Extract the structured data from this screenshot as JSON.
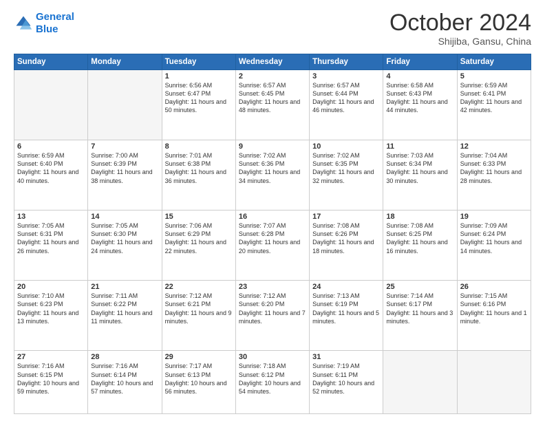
{
  "logo": {
    "line1": "General",
    "line2": "Blue"
  },
  "title": "October 2024",
  "location": "Shijiba, Gansu, China",
  "days_header": [
    "Sunday",
    "Monday",
    "Tuesday",
    "Wednesday",
    "Thursday",
    "Friday",
    "Saturday"
  ],
  "weeks": [
    [
      {
        "day": "",
        "info": ""
      },
      {
        "day": "",
        "info": ""
      },
      {
        "day": "1",
        "info": "Sunrise: 6:56 AM\nSunset: 6:47 PM\nDaylight: 11 hours and 50 minutes."
      },
      {
        "day": "2",
        "info": "Sunrise: 6:57 AM\nSunset: 6:45 PM\nDaylight: 11 hours and 48 minutes."
      },
      {
        "day": "3",
        "info": "Sunrise: 6:57 AM\nSunset: 6:44 PM\nDaylight: 11 hours and 46 minutes."
      },
      {
        "day": "4",
        "info": "Sunrise: 6:58 AM\nSunset: 6:43 PM\nDaylight: 11 hours and 44 minutes."
      },
      {
        "day": "5",
        "info": "Sunrise: 6:59 AM\nSunset: 6:41 PM\nDaylight: 11 hours and 42 minutes."
      }
    ],
    [
      {
        "day": "6",
        "info": "Sunrise: 6:59 AM\nSunset: 6:40 PM\nDaylight: 11 hours and 40 minutes."
      },
      {
        "day": "7",
        "info": "Sunrise: 7:00 AM\nSunset: 6:39 PM\nDaylight: 11 hours and 38 minutes."
      },
      {
        "day": "8",
        "info": "Sunrise: 7:01 AM\nSunset: 6:38 PM\nDaylight: 11 hours and 36 minutes."
      },
      {
        "day": "9",
        "info": "Sunrise: 7:02 AM\nSunset: 6:36 PM\nDaylight: 11 hours and 34 minutes."
      },
      {
        "day": "10",
        "info": "Sunrise: 7:02 AM\nSunset: 6:35 PM\nDaylight: 11 hours and 32 minutes."
      },
      {
        "day": "11",
        "info": "Sunrise: 7:03 AM\nSunset: 6:34 PM\nDaylight: 11 hours and 30 minutes."
      },
      {
        "day": "12",
        "info": "Sunrise: 7:04 AM\nSunset: 6:33 PM\nDaylight: 11 hours and 28 minutes."
      }
    ],
    [
      {
        "day": "13",
        "info": "Sunrise: 7:05 AM\nSunset: 6:31 PM\nDaylight: 11 hours and 26 minutes."
      },
      {
        "day": "14",
        "info": "Sunrise: 7:05 AM\nSunset: 6:30 PM\nDaylight: 11 hours and 24 minutes."
      },
      {
        "day": "15",
        "info": "Sunrise: 7:06 AM\nSunset: 6:29 PM\nDaylight: 11 hours and 22 minutes."
      },
      {
        "day": "16",
        "info": "Sunrise: 7:07 AM\nSunset: 6:28 PM\nDaylight: 11 hours and 20 minutes."
      },
      {
        "day": "17",
        "info": "Sunrise: 7:08 AM\nSunset: 6:26 PM\nDaylight: 11 hours and 18 minutes."
      },
      {
        "day": "18",
        "info": "Sunrise: 7:08 AM\nSunset: 6:25 PM\nDaylight: 11 hours and 16 minutes."
      },
      {
        "day": "19",
        "info": "Sunrise: 7:09 AM\nSunset: 6:24 PM\nDaylight: 11 hours and 14 minutes."
      }
    ],
    [
      {
        "day": "20",
        "info": "Sunrise: 7:10 AM\nSunset: 6:23 PM\nDaylight: 11 hours and 13 minutes."
      },
      {
        "day": "21",
        "info": "Sunrise: 7:11 AM\nSunset: 6:22 PM\nDaylight: 11 hours and 11 minutes."
      },
      {
        "day": "22",
        "info": "Sunrise: 7:12 AM\nSunset: 6:21 PM\nDaylight: 11 hours and 9 minutes."
      },
      {
        "day": "23",
        "info": "Sunrise: 7:12 AM\nSunset: 6:20 PM\nDaylight: 11 hours and 7 minutes."
      },
      {
        "day": "24",
        "info": "Sunrise: 7:13 AM\nSunset: 6:19 PM\nDaylight: 11 hours and 5 minutes."
      },
      {
        "day": "25",
        "info": "Sunrise: 7:14 AM\nSunset: 6:17 PM\nDaylight: 11 hours and 3 minutes."
      },
      {
        "day": "26",
        "info": "Sunrise: 7:15 AM\nSunset: 6:16 PM\nDaylight: 11 hours and 1 minute."
      }
    ],
    [
      {
        "day": "27",
        "info": "Sunrise: 7:16 AM\nSunset: 6:15 PM\nDaylight: 10 hours and 59 minutes."
      },
      {
        "day": "28",
        "info": "Sunrise: 7:16 AM\nSunset: 6:14 PM\nDaylight: 10 hours and 57 minutes."
      },
      {
        "day": "29",
        "info": "Sunrise: 7:17 AM\nSunset: 6:13 PM\nDaylight: 10 hours and 56 minutes."
      },
      {
        "day": "30",
        "info": "Sunrise: 7:18 AM\nSunset: 6:12 PM\nDaylight: 10 hours and 54 minutes."
      },
      {
        "day": "31",
        "info": "Sunrise: 7:19 AM\nSunset: 6:11 PM\nDaylight: 10 hours and 52 minutes."
      },
      {
        "day": "",
        "info": ""
      },
      {
        "day": "",
        "info": ""
      }
    ]
  ]
}
